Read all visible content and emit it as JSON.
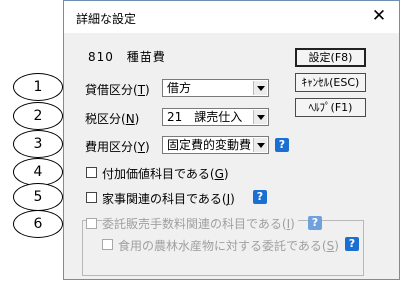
{
  "dialog": {
    "title": "詳細な設定",
    "close_glyph": "✕"
  },
  "account": {
    "code": "810",
    "name": "種苗費"
  },
  "buttons": {
    "settings": "設定(F8)",
    "cancel": "ｷｬﾝｾﾙ(ESC)",
    "help": "ﾍﾙﾌﾟ(F1)"
  },
  "rows": {
    "lending_borrowing": {
      "label": "貸借区分(",
      "key": "T",
      "tail": ")",
      "value": "借方"
    },
    "tax": {
      "label": "税区分(",
      "key": "N",
      "tail": ")",
      "value": "21　課売仕入"
    },
    "cost": {
      "label": "費用区分(",
      "key": "Y",
      "tail": ")",
      "value": "固定費的変動費"
    }
  },
  "checkboxes": {
    "value_added": {
      "label": "付加価値科目である(",
      "key": "G",
      "tail": ")"
    },
    "household": {
      "label": "家事関連の科目である(",
      "key": "J",
      "tail": ")"
    },
    "consignment": {
      "label": "委託販売手数料関連の科目である(",
      "key": "I",
      "tail": ")"
    },
    "food_consignment": {
      "label": "食用の農林水産物に対する委託である(",
      "key": "S",
      "tail": ")"
    }
  },
  "help_glyph": "?",
  "callouts": [
    "1",
    "2",
    "3",
    "4",
    "5",
    "6"
  ],
  "colors": {
    "help_blue": "#1a6fd1",
    "disabled_text": "#a0a0a0"
  }
}
